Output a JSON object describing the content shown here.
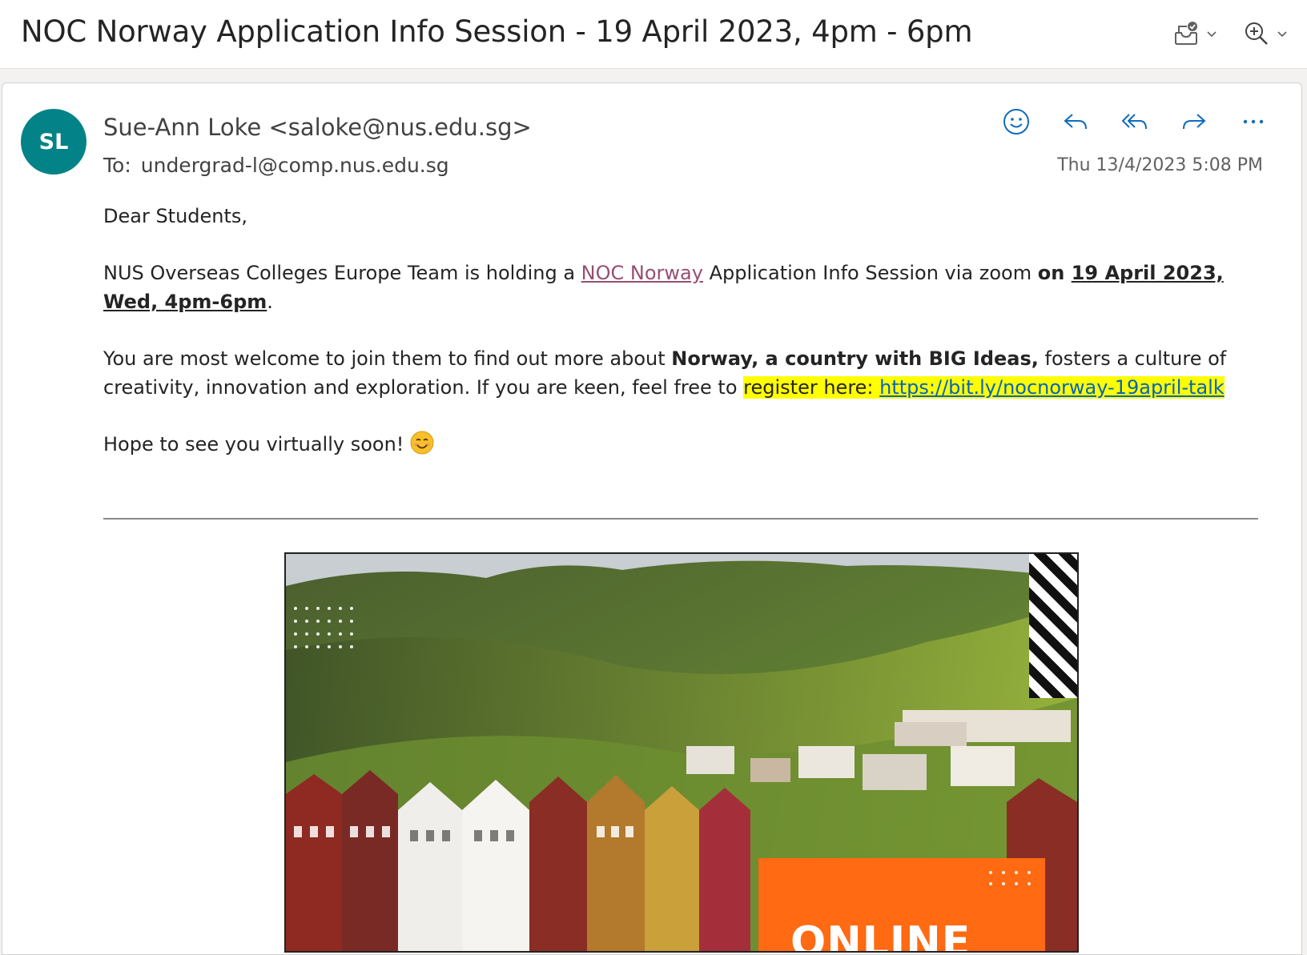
{
  "subject": {
    "title": "NOC Norway Application Info Session - 19 April 2023, 4pm - 6pm"
  },
  "icons": {
    "mark_status": "mailbox-check-icon",
    "zoom": "zoom-in-icon",
    "emoji_reaction": "smiley-icon",
    "reply": "reply-icon",
    "reply_all": "reply-all-icon",
    "forward": "forward-icon",
    "more": "more-actions-icon"
  },
  "colors": {
    "avatar_bg": "#038387",
    "link": "#0563c1",
    "visited_link": "#954f72",
    "highlight": "#ffff00",
    "action_icon": "#0f6cbd",
    "poster_badge": "#ff6a13"
  },
  "message": {
    "avatar_initials": "SL",
    "sender": "Sue-Ann Loke <saloke@nus.edu.sg>",
    "to_label": "To:",
    "to_value": "undergrad-l@comp.nus.edu.sg",
    "timestamp": "Thu 13/4/2023 5:08 PM"
  },
  "body": {
    "greeting": "Dear Students,",
    "p1_a": "NUS Overseas Colleges Europe Team is holding a ",
    "p1_link": "NOC Norway",
    "p1_b": " Application Info Session via zoom ",
    "p1_bold_on": "on ",
    "p1_date": "19 April 2023, Wed, 4pm-6pm",
    "p1_end": ".",
    "p2_a": "You are most welcome to join them to find out more about ",
    "p2_bold": "Norway, a country with BIG Ideas,",
    "p2_b": " fosters a culture of creativity, innovation and exploration.  If you are keen, feel free to ",
    "p2_hl": "register here: ",
    "p2_link": "https://bit.ly/nocnorway-19april-talk",
    "p3": "Hope to see you virtually soon!"
  },
  "poster": {
    "badge_text": "ONLINE"
  }
}
